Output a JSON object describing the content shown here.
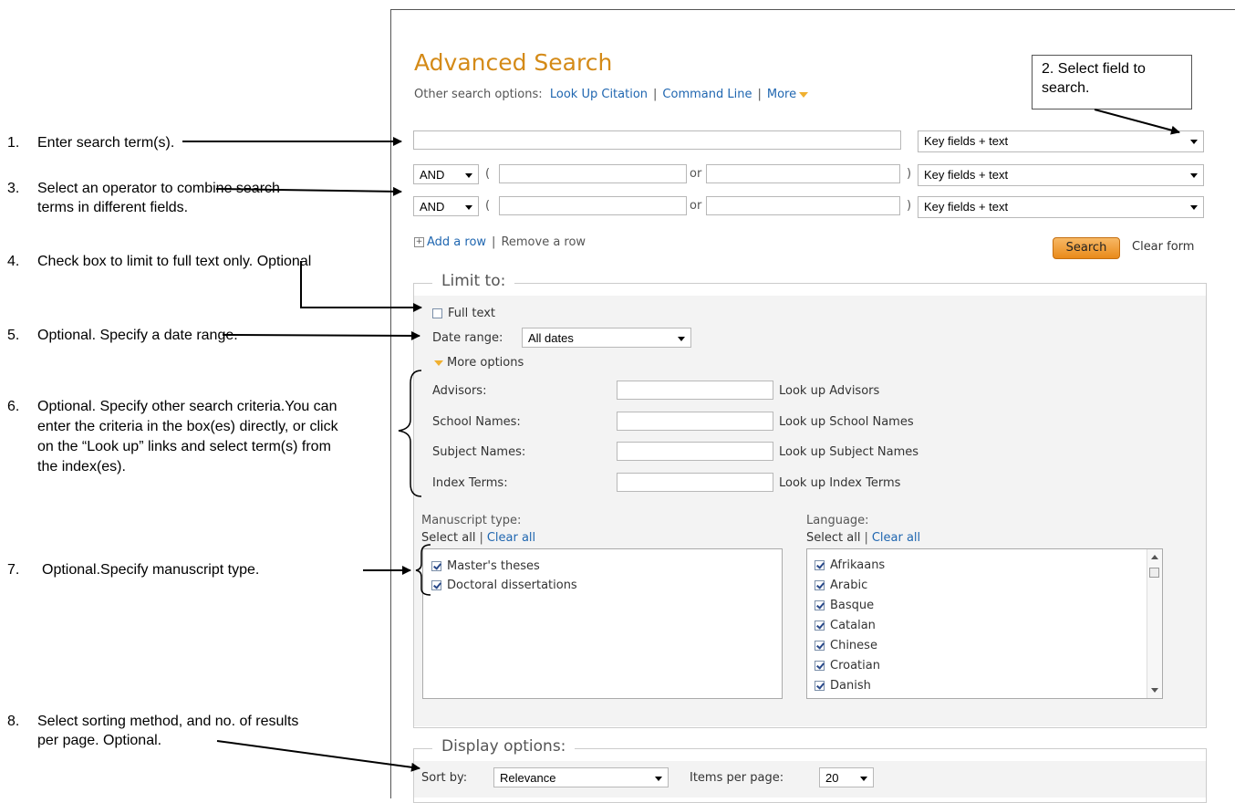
{
  "annotations": [
    {
      "num": "1.",
      "text": "Enter search term(s)."
    },
    {
      "num": "3.",
      "text": "Select an operator to combine search terms in different fields."
    },
    {
      "num": "4.",
      "text": "Check box to limit to full text only. Optional"
    },
    {
      "num": "5.",
      "text": "Optional. Specify a date range."
    },
    {
      "num": "6.",
      "text": "Optional. Specify other search criteria.You can enter the criteria in the box(es) directly, or click on the “Look up” links and select term(s) from the index(es)."
    },
    {
      "num": "7.",
      "text": "Optional.Specify manuscript type."
    },
    {
      "num": "8.",
      "text": "Select sorting method, and no. of results per page. Optional."
    }
  ],
  "callout": "2. Select field to search.",
  "page": {
    "title": "Advanced Search",
    "other_options_label": "Other search options:",
    "other_options": [
      "Look Up Citation",
      "Command Line",
      "More"
    ]
  },
  "search_rows": {
    "field_default": "Key fields + text",
    "operator": "AND",
    "or_label": "or",
    "open_paren": "(",
    "close_paren": ")"
  },
  "row_actions": {
    "add": "Add a row",
    "remove": "Remove a row"
  },
  "buttons": {
    "search": "Search",
    "clear": "Clear form"
  },
  "limit": {
    "legend": "Limit to:",
    "full_text": "Full text",
    "date_label": "Date range:",
    "date_value": "All dates",
    "more_options": "More options",
    "criteria": [
      {
        "label": "Advisors:",
        "link": "Look up Advisors"
      },
      {
        "label": "School Names:",
        "link": "Look up School Names"
      },
      {
        "label": "Subject Names:",
        "link": "Look up Subject Names"
      },
      {
        "label": "Index Terms:",
        "link": "Look up Index Terms"
      }
    ],
    "manuscript": {
      "label": "Manuscript type:",
      "select_all": "Select all",
      "clear_all": "Clear all",
      "items": [
        "Master's theses",
        "Doctoral dissertations"
      ]
    },
    "language": {
      "label": "Language:",
      "select_all": "Select all",
      "clear_all": "Clear all",
      "items": [
        "Afrikaans",
        "Arabic",
        "Basque",
        "Catalan",
        "Chinese",
        "Croatian",
        "Danish"
      ]
    }
  },
  "display": {
    "legend": "Display options:",
    "sort_label": "Sort by:",
    "sort_value": "Relevance",
    "items_label": "Items per page:",
    "items_value": "20"
  }
}
